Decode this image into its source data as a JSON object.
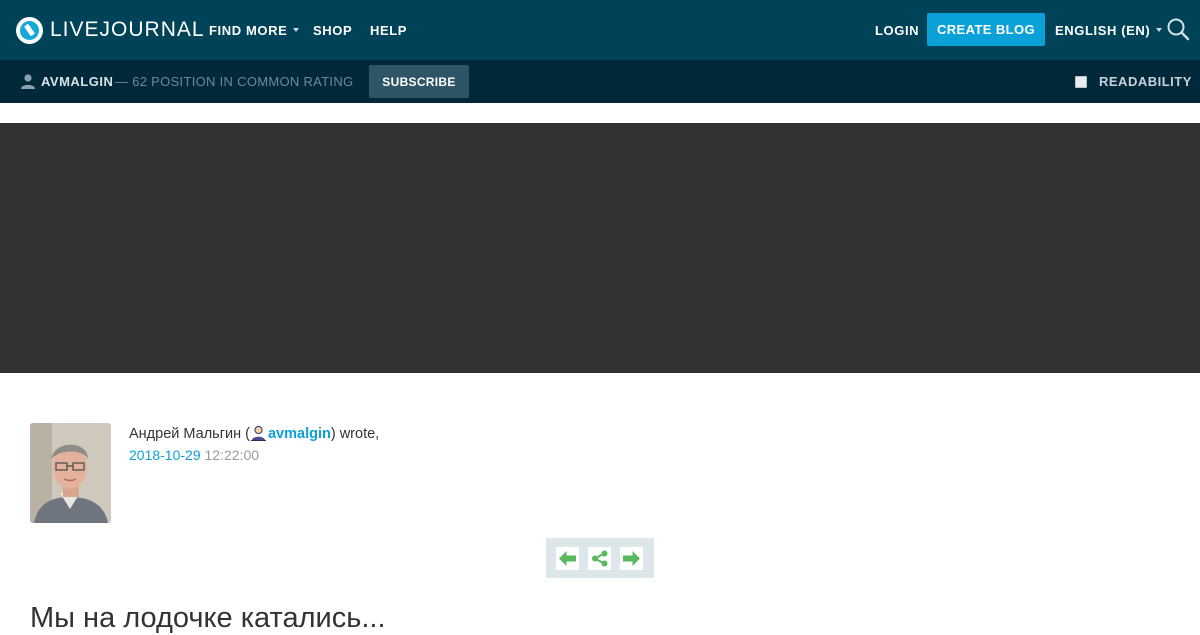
{
  "header": {
    "logo_text": "LIVEJOURNAL",
    "nav": {
      "find_more": "FIND MORE",
      "shop": "SHOP",
      "help": "HELP",
      "login": "LOGIN",
      "create_blog": "CREATE BLOG",
      "language": "ENGLISH (EN)"
    },
    "icons": {
      "search": "search-icon",
      "logo": "livejournal-logo-icon"
    },
    "colors": {
      "bar": "#004359",
      "accent": "#0aa0d8"
    }
  },
  "journal_bar": {
    "username": "AVMALGIN",
    "rating": "— 62 POSITION IN COMMON RATING",
    "subscribe": "SUBSCRIBE",
    "readability": "READABILITY",
    "readability_checked": false,
    "colors": {
      "bar": "#01293a"
    }
  },
  "post": {
    "author_name": "Андрей Мальгин (",
    "author_username": "avmalgin",
    "author_suffix": ") wrote,",
    "date": "2018-10-29",
    "time": "12:22:00",
    "title": "Мы на лодочке катались..."
  },
  "post_nav": {
    "icons": [
      "prev-arrow-icon",
      "share-icon",
      "next-arrow-icon"
    ],
    "accent": "#59b85d"
  }
}
